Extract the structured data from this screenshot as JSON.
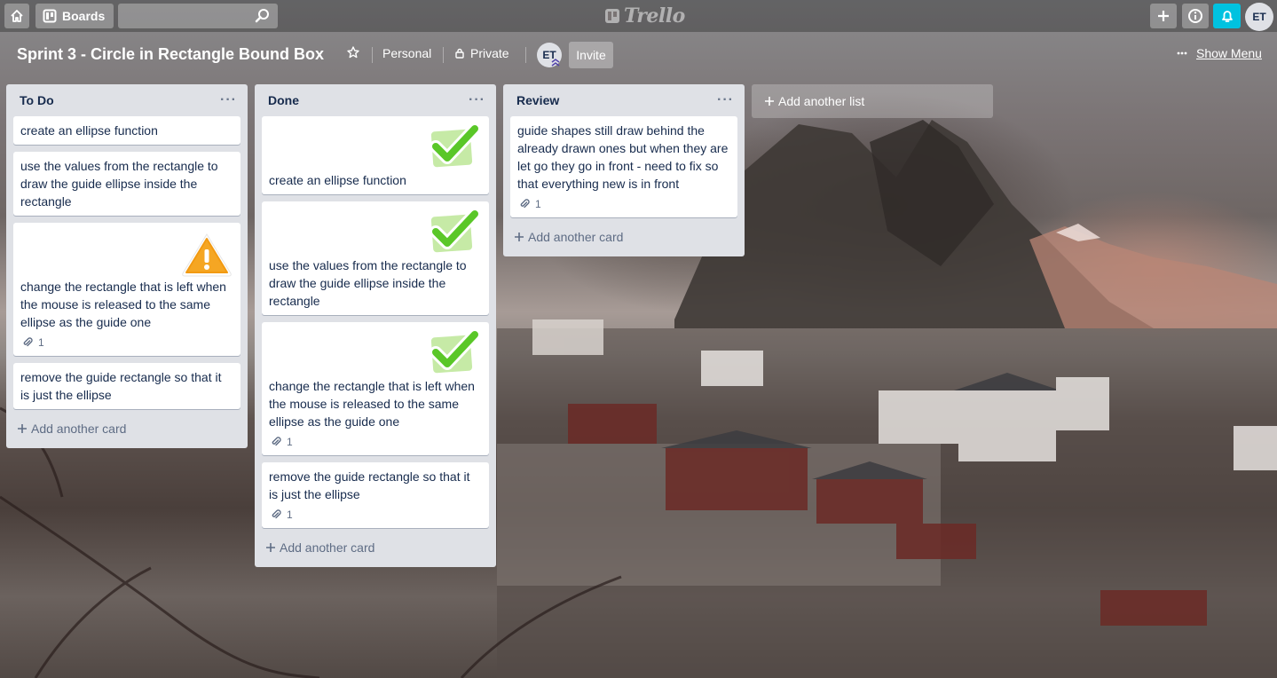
{
  "header": {
    "boards_label": "Boards",
    "search_value": "",
    "logo_text": "Trello",
    "avatar_initials": "ET"
  },
  "board": {
    "title": "Sprint 3 - Circle in Rectangle Bound Box",
    "team": "Personal",
    "visibility": "Private",
    "member_initials": "ET",
    "invite_label": "Invite",
    "show_menu_label": "Show Menu",
    "add_list_label": "Add another list"
  },
  "colors": {
    "notification_accent": "#00c2e0",
    "sticker_check": "#5ac728",
    "sticker_warning": "#f5a623"
  },
  "lists": [
    {
      "title": "To Do",
      "add_card_label": "Add another card",
      "cards": [
        {
          "text": "create an ellipse function"
        },
        {
          "text": "use the values from the rectangle to draw the guide ellipse inside the rectangle"
        },
        {
          "text": "change the rectangle that is left when the mouse is released to the same ellipse as the guide one",
          "sticker": "warning-icon",
          "attachments": "1"
        },
        {
          "text": "remove the guide rectangle so that it is just the ellipse"
        }
      ]
    },
    {
      "title": "Done",
      "add_card_label": "Add another card",
      "cards": [
        {
          "text": "create an ellipse function",
          "sticker": "check-icon"
        },
        {
          "text": "use the values from the rectangle to draw the guide ellipse inside the rectangle",
          "sticker": "check-icon"
        },
        {
          "text": "change the rectangle that is left when the mouse is released to the same ellipse as the guide one",
          "sticker": "check-icon",
          "attachments": "1"
        },
        {
          "text": "remove the guide rectangle so that it is just the ellipse",
          "attachments": "1"
        }
      ]
    },
    {
      "title": "Review",
      "add_card_label": "Add another card",
      "cards": [
        {
          "text": "guide shapes still draw behind the already drawn ones but when they are let go they go in front - need to fix so that everything new is in front",
          "attachments": "1"
        }
      ]
    }
  ]
}
